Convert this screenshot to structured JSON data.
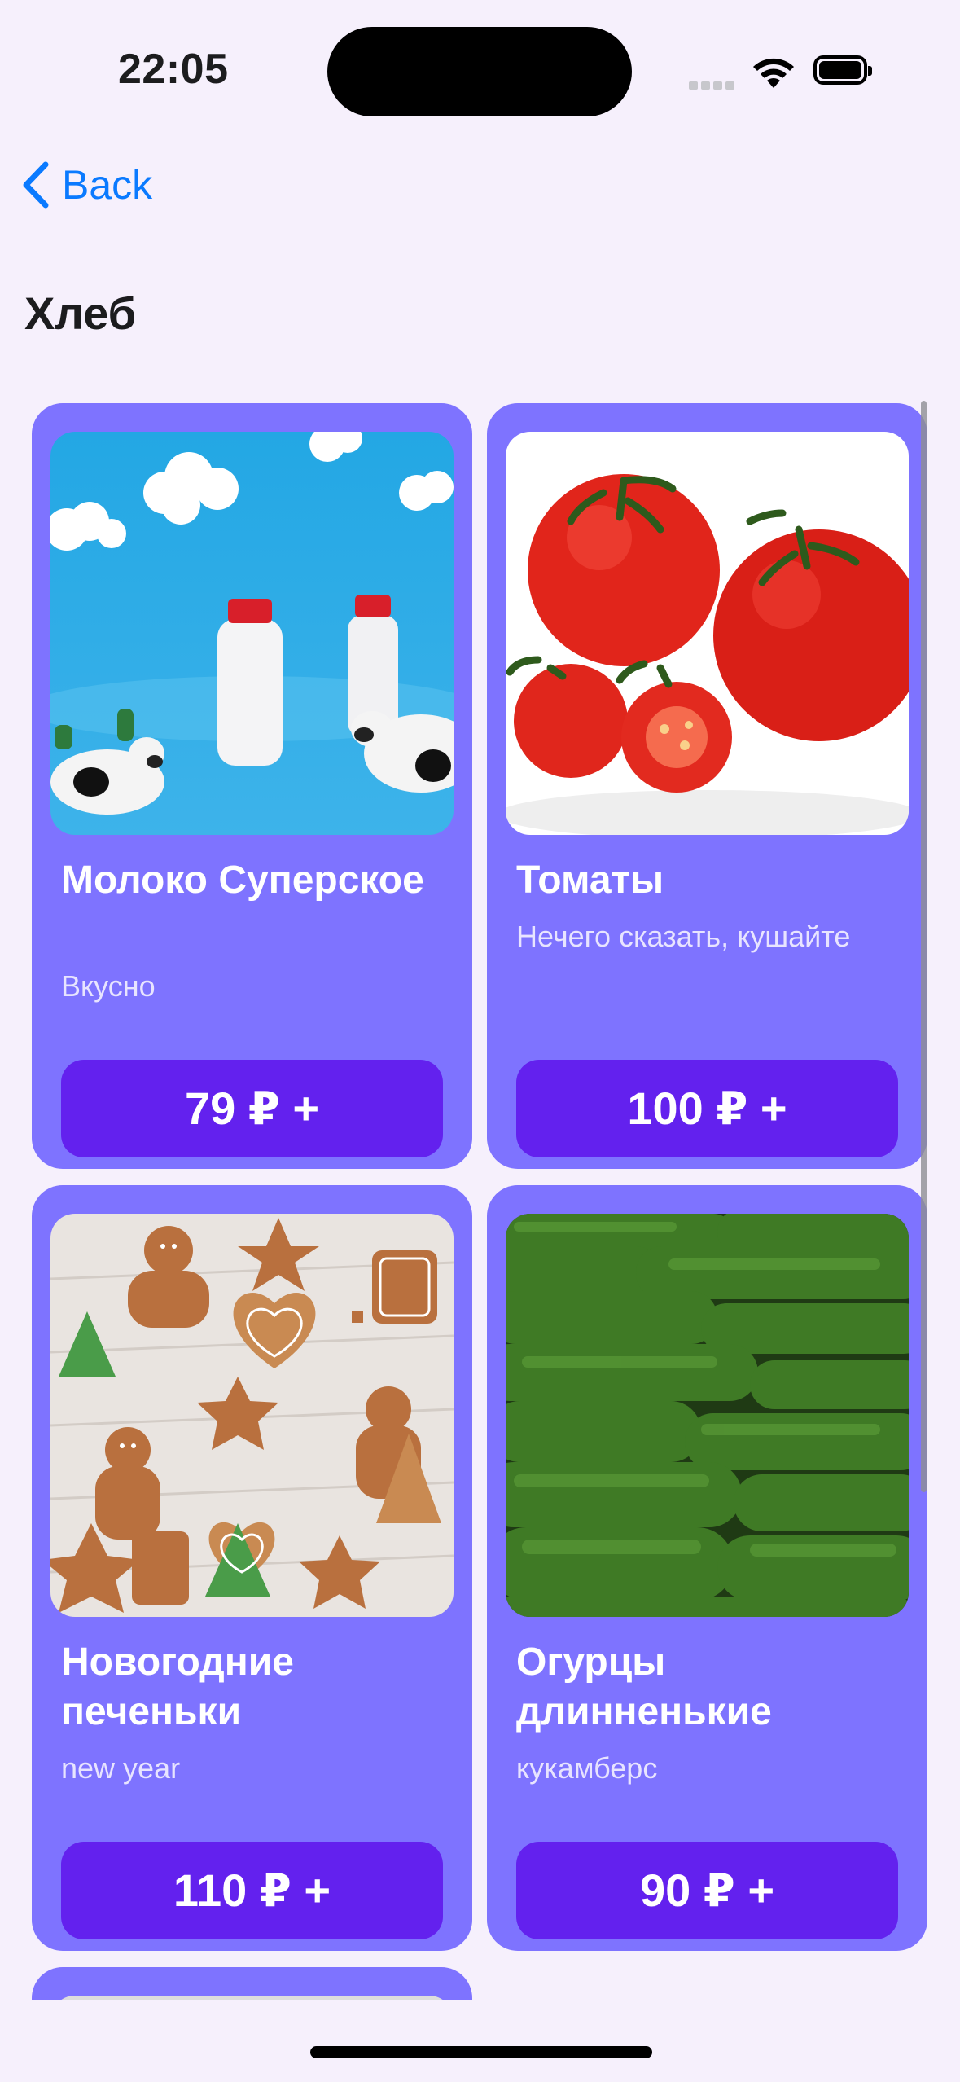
{
  "status_bar": {
    "time": "22:05"
  },
  "nav": {
    "back_label": "Back"
  },
  "page": {
    "title": "Хлеб"
  },
  "products": [
    {
      "title": "Молоко Суперское",
      "subtitle": "Вкусно",
      "price_label": "79 ₽ +",
      "image": "milk-bottles-with-cows"
    },
    {
      "title": "Томаты",
      "subtitle": "Нечего сказать, кушайте",
      "price_label": "100 ₽ +",
      "image": "tomatoes"
    },
    {
      "title": "Новогодние печеньки",
      "subtitle": "new year",
      "price_label": "110 ₽ +",
      "image": "gingerbread-cookies"
    },
    {
      "title": "Огурцы длинненькие",
      "subtitle": "кукамберс",
      "price_label": "90 ₽ +",
      "image": "cucumbers"
    }
  ],
  "colors": {
    "background": "#F6F0FC",
    "card": "#7E73FF",
    "price_button": "#6321EE",
    "link": "#0A7AFF"
  }
}
